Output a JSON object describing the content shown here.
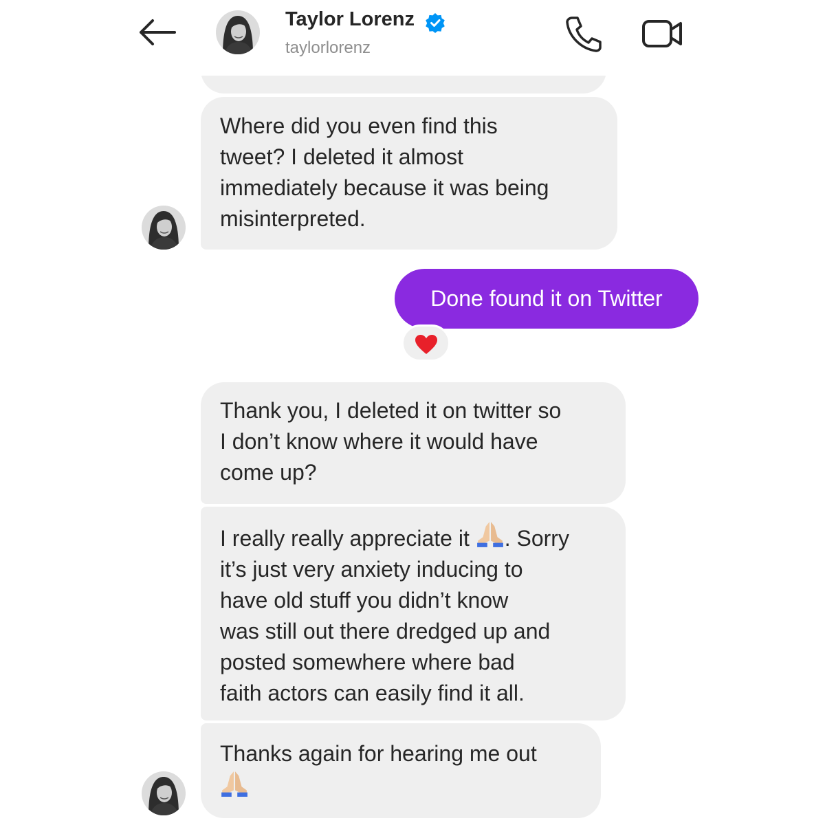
{
  "header": {
    "contact_name": "Taylor Lorenz",
    "contact_handle": "taylorlorenz",
    "verified_color": "#0095f6",
    "icons": [
      "back-arrow-icon",
      "avatar",
      "verified-badge-icon",
      "phone-icon",
      "video-camera-icon"
    ]
  },
  "messages": [
    {
      "direction": "incoming",
      "text": "Where did you even find this\ntweet? I deleted it almost\nimmediately because it was being\nmisinterpreted."
    },
    {
      "direction": "outgoing",
      "text": "Done found it on Twitter",
      "reaction": "heart-emoji"
    },
    {
      "direction": "incoming",
      "text": "Thank you, I deleted it on twitter so\nI don’t know where it would have\ncome up?"
    },
    {
      "direction": "incoming",
      "text_before": "I really really appreciate it ",
      "emoji": "folded-hands-emoji",
      "text_after": ". Sorry\nit’s just very anxiety inducing to\nhave old stuff you didn’t know\nwas still out there dredged up and\nposted somewhere where bad\nfaith actors can easily find it all."
    },
    {
      "direction": "incoming",
      "text": "Thanks again for hearing me out",
      "emoji": "folded-hands-emoji"
    }
  ],
  "colors": {
    "outgoing_bubble": "#8a2ae0",
    "incoming_bubble": "#efefef",
    "text": "#262626",
    "secondary_text": "#8e8e8e",
    "reaction_heart": "#e8202a"
  }
}
